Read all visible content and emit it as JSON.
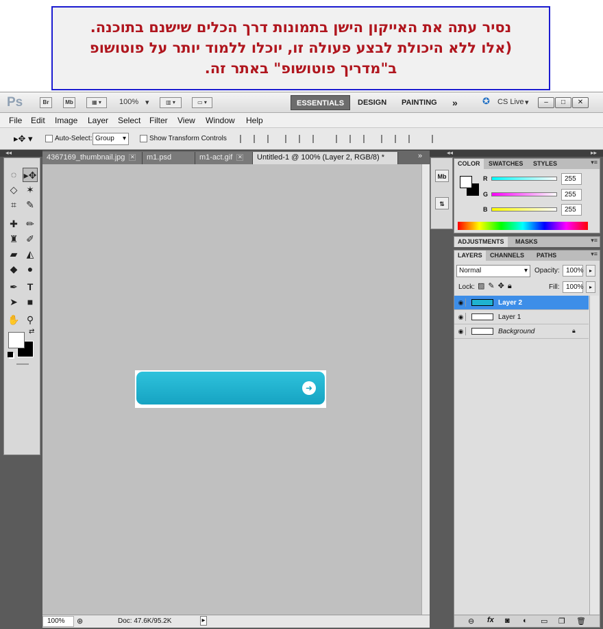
{
  "note": {
    "line1": "נסיר עתה את האייקון הישן בתמונות דרך הכלים שישנם בתוכנה.",
    "line2": "(אלו ללא היכולת לבצע פעולה זו, יוכלו ללמוד יותר על פוטושופ",
    "line3": "ב\"מדריך פוטושופ\" באתר זה."
  },
  "appbar": {
    "logo": "Ps",
    "br": "Br",
    "mb": "Mb",
    "zoom": "100%",
    "workspaces": [
      "ESSENTIALS",
      "DESIGN",
      "PAINTING"
    ],
    "more": "»",
    "cslive": "CS Live"
  },
  "menu": [
    "File",
    "Edit",
    "Image",
    "Layer",
    "Select",
    "Filter",
    "View",
    "Window",
    "Help"
  ],
  "options": {
    "auto_select": "Auto-Select:",
    "group": "Group",
    "show_transform": "Show Transform Controls"
  },
  "tabs": [
    {
      "label": "4367169_thumbnail.jpg"
    },
    {
      "label": "m1.psd"
    },
    {
      "label": "m1-act.gif"
    },
    {
      "label": "Untitled-1 @ 100% (Layer 2, RGB/8) *"
    }
  ],
  "status": {
    "zoom": "100%",
    "doc": "Doc: 47.6K/95.2K"
  },
  "color_panel": {
    "tabs": [
      "COLOR",
      "SWATCHES",
      "STYLES"
    ],
    "r_label": "R",
    "g_label": "G",
    "b_label": "B",
    "r": "255",
    "g": "255",
    "b": "255"
  },
  "adjust_panel": {
    "tabs": [
      "ADJUSTMENTS",
      "MASKS"
    ]
  },
  "layers_panel": {
    "tabs": [
      "LAYERS",
      "CHANNELS",
      "PATHS"
    ],
    "blend": "Normal",
    "opacity_label": "Opacity:",
    "opacity": "100%",
    "lock_label": "Lock:",
    "fill_label": "Fill:",
    "fill": "100%",
    "layers": [
      "Layer 2",
      "Layer 1",
      "Background"
    ]
  },
  "colors": {
    "accent_cyan": "#1fb3d0",
    "layer_selected": "#3d8ee8"
  }
}
